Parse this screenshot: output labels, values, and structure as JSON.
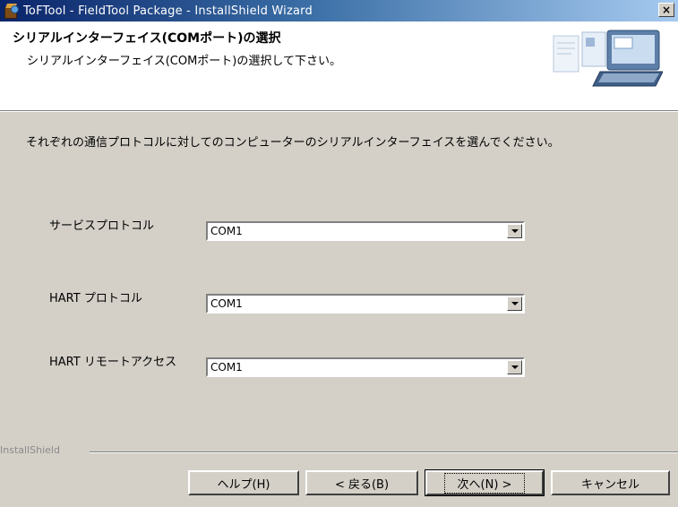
{
  "window": {
    "title": "ToFTool - FieldTool Package - InstallShield Wizard",
    "close_glyph": "×"
  },
  "header": {
    "title": "シリアルインターフェイス(COMポート)の選択",
    "subtitle": "シリアルインターフェイス(COMポート)の選択して下さい。"
  },
  "main": {
    "instruction": "それぞれの通信プロトコルに対してのコンピューターのシリアルインターフェイスを選んでください。",
    "fields": [
      {
        "label": "サービスプロトコル",
        "value": "COM1"
      },
      {
        "label": "HART プロトコル",
        "value": "COM1"
      },
      {
        "label": "HART リモートアクセス",
        "value": "COM1"
      }
    ]
  },
  "footer": {
    "brand": "InstallShield",
    "buttons": {
      "help": "ヘルプ(H)",
      "back": "< 戻る(B)",
      "next": "次へ(N) >",
      "cancel": "キャンセル"
    }
  },
  "icons": [
    "installer-box-icon",
    "close-icon",
    "laptop-graphic",
    "dropdown-arrow-icon"
  ],
  "colors": {
    "titlebar_start": "#0a246a",
    "titlebar_end": "#a6caf0",
    "dialog_bg": "#d4d0c8"
  }
}
